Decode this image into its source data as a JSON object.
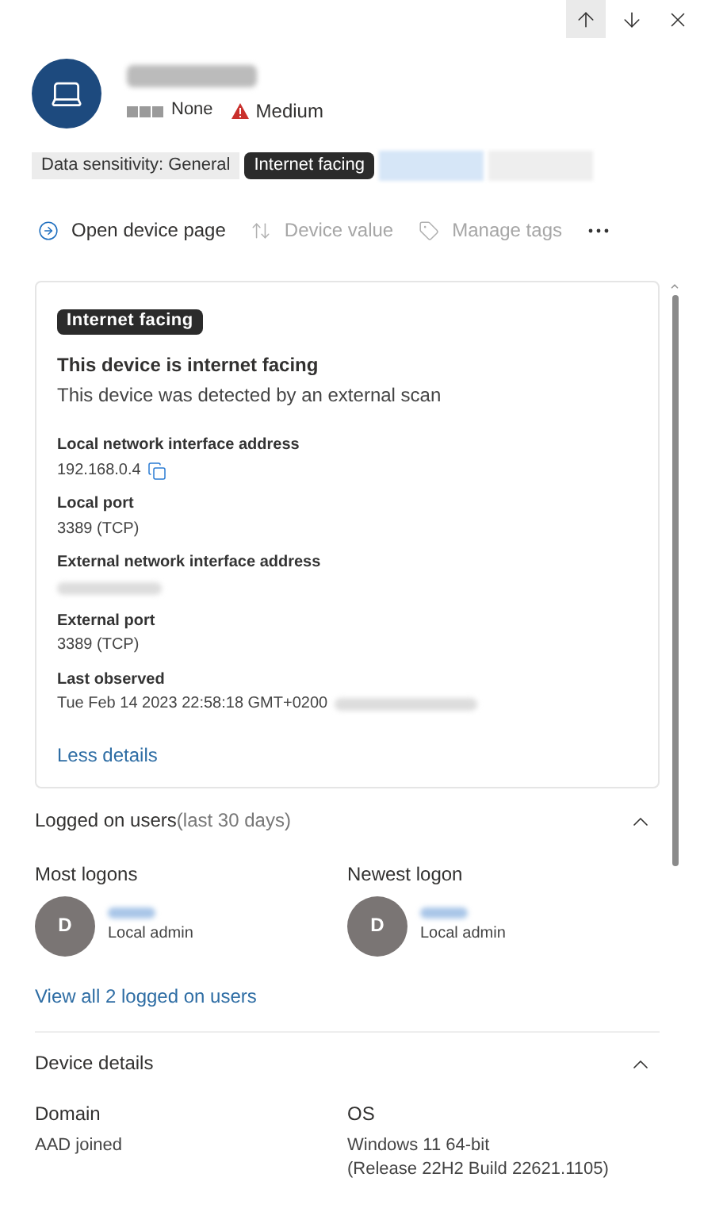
{
  "header": {
    "device_name_redacted": true,
    "criticality": "None",
    "risk": "Medium"
  },
  "tags": [
    {
      "label": "Data sensitivity: General",
      "kind": "plain"
    },
    {
      "label": "Internet facing",
      "kind": "dark"
    },
    {
      "kind": "redacted",
      "color": "#d6e6f7"
    },
    {
      "kind": "redacted",
      "color": "#eeeeee"
    }
  ],
  "actions": [
    {
      "label": "Open device page",
      "disabled": false
    },
    {
      "label": "Device value",
      "disabled": true
    },
    {
      "label": "Manage tags",
      "disabled": true
    }
  ],
  "card": {
    "badge": "Internet facing",
    "title": "This device is internet facing",
    "subtitle": "This device was detected by an external scan",
    "fields": [
      {
        "label": "Local network interface address",
        "value": "192.168.0.4",
        "copyable": true
      },
      {
        "label": "Local port",
        "value": "3389 (TCP)"
      },
      {
        "label": "External network interface address",
        "redacted": true
      },
      {
        "label": "External port",
        "value": "3389 (TCP)"
      },
      {
        "label": "Last observed",
        "value": "Tue Feb 14 2023 22:58:18 GMT+0200",
        "redacted_suffix": true
      }
    ],
    "link": "Less details"
  },
  "logged_on_users": {
    "title": "Logged on users",
    "note": "(last 30 days)",
    "expanded": true,
    "users": [
      {
        "heading": "Most logons",
        "initial": "D",
        "role": "Local admin"
      },
      {
        "heading": "Newest logon",
        "initial": "D",
        "role": "Local admin"
      }
    ],
    "link": "View all 2 logged on users"
  },
  "device_details": {
    "title": "Device details",
    "expanded": true,
    "fields": [
      {
        "label": "Domain",
        "lines": [
          "AAD joined"
        ]
      },
      {
        "label": "OS",
        "lines": [
          "Windows 11 64-bit",
          "(Release 22H2 Build 22621.1105)"
        ]
      }
    ]
  }
}
